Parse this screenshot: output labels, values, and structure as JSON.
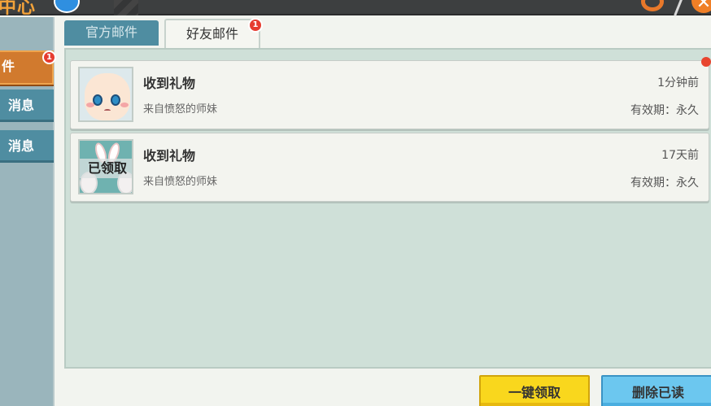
{
  "header": {
    "title": "中心",
    "icons": [
      "info-icon",
      "gear-icon",
      "close-icon"
    ]
  },
  "sidebar": {
    "items": [
      {
        "label": "件",
        "active": true,
        "badge": "1"
      },
      {
        "label": "消息",
        "active": false
      },
      {
        "label": "消息",
        "active": false
      }
    ]
  },
  "tabs": [
    {
      "label": "官方邮件",
      "active": false
    },
    {
      "label": "好友邮件",
      "active": true,
      "badge": "1"
    }
  ],
  "mails": [
    {
      "subject": "收到礼物",
      "sender": "来自愤怒的师妹",
      "time": "1分钟前",
      "validity": "有效期：永久",
      "claimed": false,
      "unread": true
    },
    {
      "subject": "收到礼物",
      "sender": "来自愤怒的师妹",
      "time": "17天前",
      "validity": "有效期：永久",
      "claimed": true,
      "claimed_label": "已领取",
      "unread": false
    }
  ],
  "buttons": {
    "claim_all": "一键领取",
    "delete_read": "删除已读"
  },
  "colors": {
    "accent_orange": "#d17a2e",
    "tab_blue": "#4f8da1",
    "panel_green": "#cfe0d8",
    "badge_red": "#e63c2f",
    "claim_yellow": "#f9d71d",
    "delete_blue": "#6cc7ef"
  }
}
